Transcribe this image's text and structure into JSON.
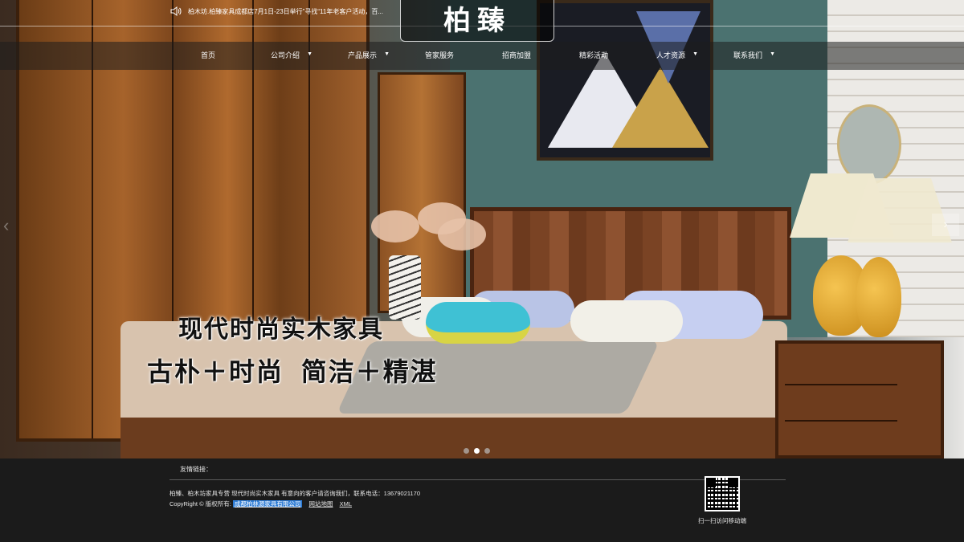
{
  "header": {
    "notice": "柏木坊.柏臻家具成都店7月1日-23日举行”寻找“11年老客户活动，百...",
    "logo_text": "柏臻",
    "nav": [
      {
        "label": "首页",
        "has_dropdown": false
      },
      {
        "label": "公司介绍",
        "has_dropdown": true
      },
      {
        "label": "产品展示",
        "has_dropdown": true
      },
      {
        "label": "管家服务",
        "has_dropdown": false
      },
      {
        "label": "招商加盟",
        "has_dropdown": false
      },
      {
        "label": "精彩活动",
        "has_dropdown": false
      },
      {
        "label": "人才资源",
        "has_dropdown": true
      },
      {
        "label": "联系我们",
        "has_dropdown": true
      }
    ],
    "caret": "▼"
  },
  "banner": {
    "slogan_1": "现代时尚实木家具",
    "slogan_2": "古朴＋时尚  简洁＋精湛",
    "arrow_left": "‹",
    "arrow_right": "›",
    "slides": 3,
    "active_slide": 2
  },
  "footer": {
    "friends_label": "友情链接：",
    "line1": "柏臻、柏木坊家具专营 现代时尚实木家具 有意向的客户请咨询我们，联系电话：13679021170",
    "copyright_label": "CopyRight © 版权所有:",
    "company_link": "成都柏林源家具有限公司",
    "sitemap_link": "网站地图",
    "xml_link": "XML",
    "qr_caption": "扫一扫访问移动端"
  },
  "colors": {
    "header_bg": "#1e1e1e",
    "footer_bg": "#1b1b1b",
    "link_highlight": "#2d7bd4"
  }
}
